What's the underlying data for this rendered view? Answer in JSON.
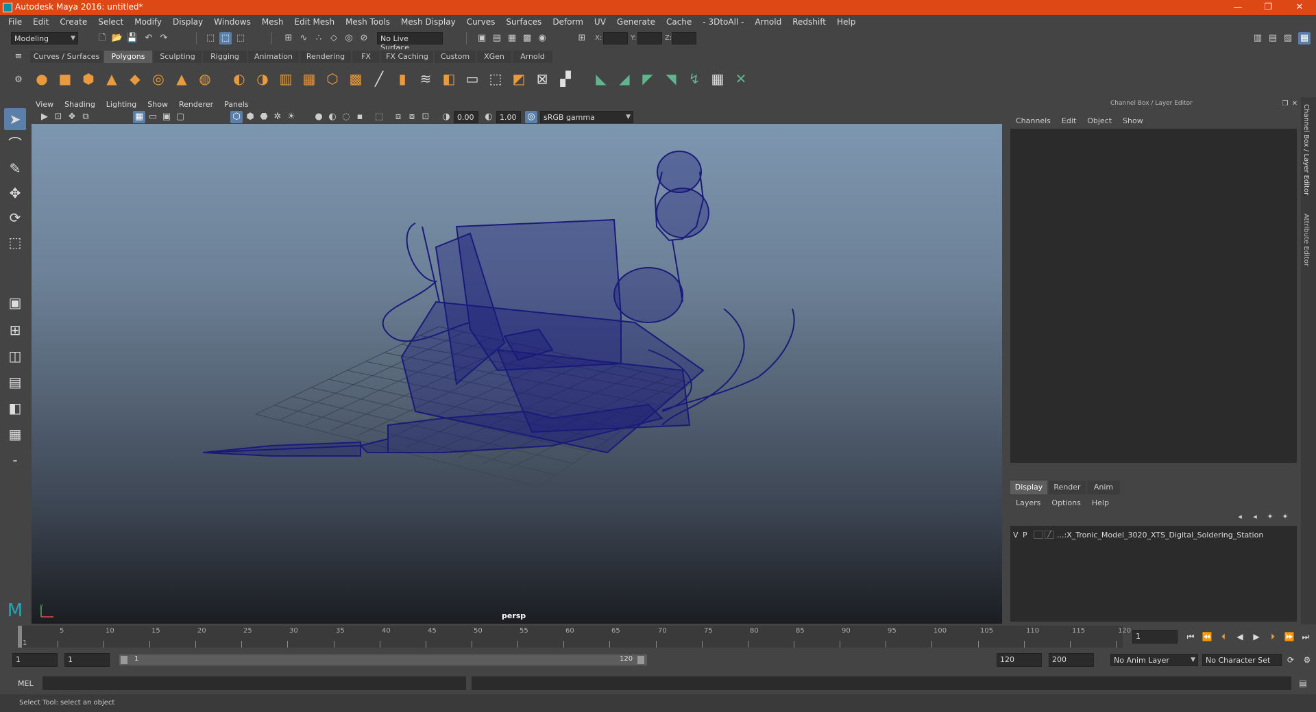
{
  "title": "Autodesk Maya 2016: untitled*",
  "window_controls": {
    "minimize": "—",
    "maximize": "❐",
    "close": "✕"
  },
  "menubar": [
    "File",
    "Edit",
    "Create",
    "Select",
    "Modify",
    "Display",
    "Windows",
    "Mesh",
    "Edit Mesh",
    "Mesh Tools",
    "Mesh Display",
    "Curves",
    "Surfaces",
    "Deform",
    "UV",
    "Generate",
    "Cache",
    "- 3DtoAll -",
    "Arnold",
    "Redshift",
    "Help"
  ],
  "status_line": {
    "mode": "Modeling",
    "live_surface": "No Live Surface",
    "x_label": "X:",
    "y_label": "Y:",
    "z_label": "Z:"
  },
  "shelf_tabs": [
    "Curves / Surfaces",
    "Polygons",
    "Sculpting",
    "Rigging",
    "Animation",
    "Rendering",
    "FX",
    "FX Caching",
    "Custom",
    "XGen",
    "Arnold"
  ],
  "active_shelf_tab": "Polygons",
  "viewport": {
    "menu": [
      "View",
      "Shading",
      "Lighting",
      "Show",
      "Renderer",
      "Panels"
    ],
    "exposure": "0.00",
    "gamma": "1.00",
    "color_space": "sRGB gamma",
    "camera_label": "persp"
  },
  "channel_box": {
    "title": "Channel Box / Layer Editor",
    "menu": [
      "Channels",
      "Edit",
      "Object",
      "Show"
    ]
  },
  "layer_editor": {
    "tabs": [
      "Display",
      "Render",
      "Anim"
    ],
    "active_tab": "Display",
    "menu": [
      "Layers",
      "Options",
      "Help"
    ],
    "layers": [
      {
        "v": "V",
        "p": "P",
        "name": "...:X_Tronic_Model_3020_XTS_Digital_Soldering_Station"
      }
    ]
  },
  "side_tabs": [
    "Channel Box / Layer Editor",
    "Attribute Editor"
  ],
  "timeline": {
    "ticks": [
      1,
      5,
      10,
      15,
      20,
      25,
      30,
      35,
      40,
      45,
      50,
      55,
      60,
      65,
      70,
      75,
      80,
      85,
      90,
      95,
      100,
      105,
      110,
      115,
      120
    ],
    "current_frame": "1"
  },
  "range": {
    "start": "1",
    "playback_start": "1",
    "slider_start": "1",
    "slider_end": "120",
    "playback_end": "120",
    "end": "200",
    "anim_layer": "No Anim Layer",
    "character_set": "No Character Set"
  },
  "command_line": {
    "label": "MEL"
  },
  "help_line": "Select Tool: select an object",
  "colors": {
    "title_bar": "#dd4814",
    "wireframe": "#1a1a7a",
    "accent": "#5a7fa8"
  }
}
